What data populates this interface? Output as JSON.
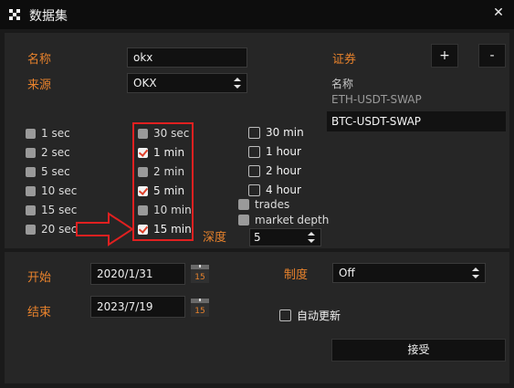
{
  "window": {
    "title": "数据集"
  },
  "form": {
    "name_label": "名称",
    "name_value": "okx",
    "source_label": "来源",
    "source_value": "OKX",
    "depth_label": "深度",
    "depth_value": "5",
    "start_label": "开始",
    "start_value": "2020/1/31",
    "end_label": "结束",
    "end_value": "2023/7/19",
    "calendar_day": "15",
    "mode_label": "制度",
    "mode_value": "Off",
    "auto_update_label": "自动更新",
    "accept_label": "接受"
  },
  "securities": {
    "label": "证券",
    "add_label": "+",
    "remove_label": "-",
    "column_header": "名称",
    "items": [
      "ETH-USDT-SWAP",
      "BTC-USDT-SWAP"
    ],
    "selected": "BTC-USDT-SWAP"
  },
  "intervals": {
    "seconds": [
      {
        "label": "1 sec",
        "checked": false
      },
      {
        "label": "2 sec",
        "checked": false
      },
      {
        "label": "5 sec",
        "checked": false
      },
      {
        "label": "10 sec",
        "checked": false
      },
      {
        "label": "15 sec",
        "checked": false
      },
      {
        "label": "20 sec",
        "checked": false
      }
    ],
    "minutes": [
      {
        "label": "30 sec",
        "checked": false
      },
      {
        "label": "1 min",
        "checked": true
      },
      {
        "label": "2 min",
        "checked": false
      },
      {
        "label": "5 min",
        "checked": true
      },
      {
        "label": "10 min",
        "checked": false
      },
      {
        "label": "15 min",
        "checked": true
      }
    ],
    "hours": [
      {
        "label": "30 min",
        "checked": false
      },
      {
        "label": "1 hour",
        "checked": false
      },
      {
        "label": "2 hour",
        "checked": false
      },
      {
        "label": "4 hour",
        "checked": false
      }
    ],
    "extra": [
      {
        "label": "trades",
        "checked": false
      },
      {
        "label": "market depth",
        "checked": false
      }
    ]
  },
  "colors": {
    "accent": "#e8822c",
    "highlight_box": "#e02020",
    "check_mark": "#e0402a"
  },
  "icons": {
    "app": "app-logo-icon",
    "close": "close-icon",
    "arrow": "right-arrow-icon",
    "calendar": "calendar-icon"
  }
}
